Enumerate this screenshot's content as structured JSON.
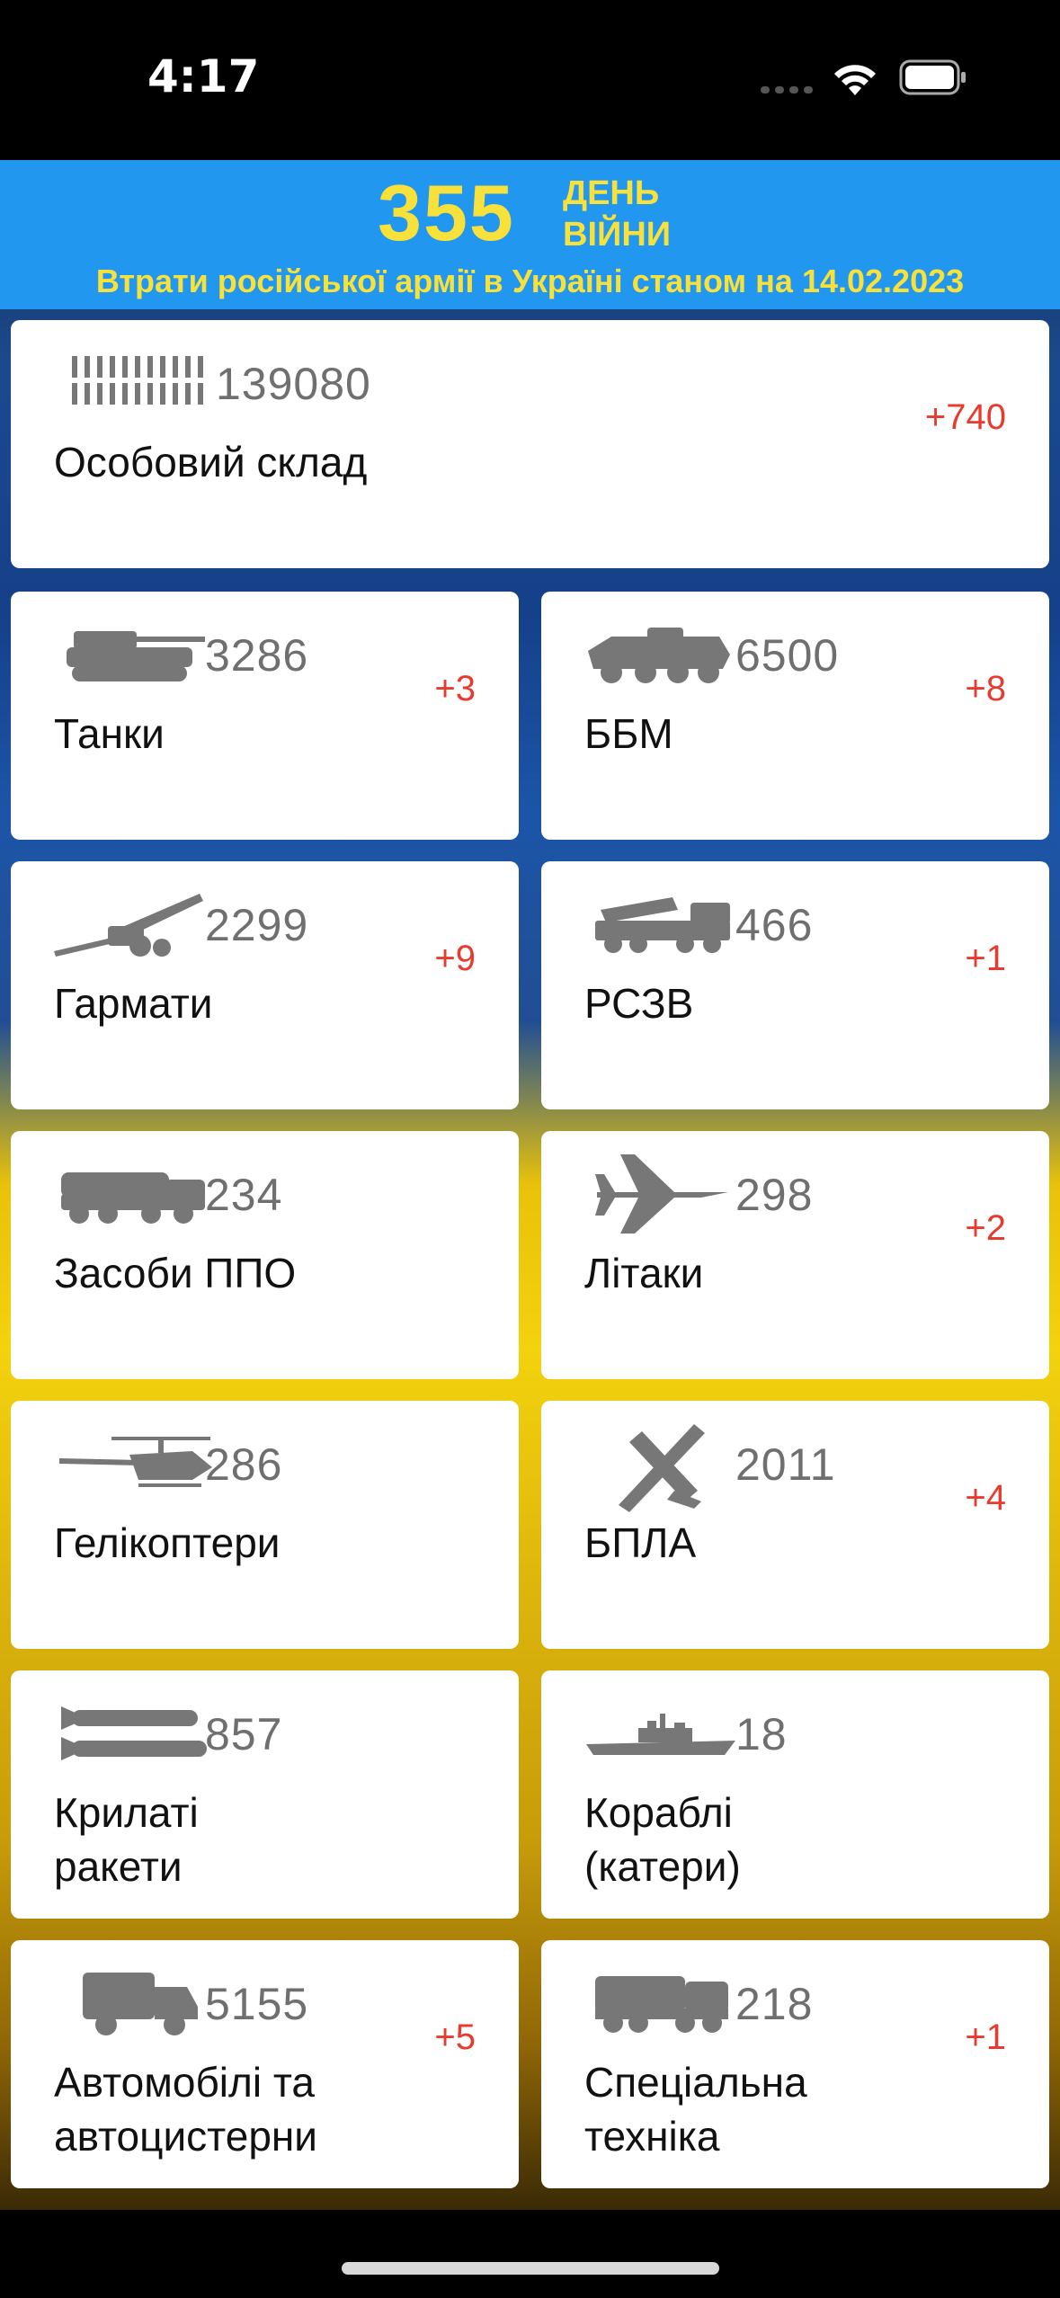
{
  "status_bar": {
    "time": "4:17"
  },
  "header": {
    "day_number": "355",
    "day_word_1": "ДЕНЬ",
    "day_word_2": "ВІЙНИ",
    "subtitle": "Втрати російської армії в Україні станом на 14.02.2023"
  },
  "colors": {
    "banner": "#2197f0",
    "title": "#f7e13a",
    "delta": "#e83b2e",
    "count": "#6f6f6f"
  },
  "cards": [
    {
      "name": "personnel",
      "icon": "soldiers-icon",
      "count": "139080",
      "delta": "+740",
      "label": "Особовий склад"
    },
    {
      "name": "tanks",
      "icon": "tank-icon",
      "count": "3286",
      "delta": "+3",
      "label": "Танки"
    },
    {
      "name": "apv",
      "icon": "armored-vehicle-icon",
      "count": "6500",
      "delta": "+8",
      "label": "ББМ"
    },
    {
      "name": "artillery",
      "icon": "howitzer-icon",
      "count": "2299",
      "delta": "+9",
      "label": "Гармати"
    },
    {
      "name": "mlrs",
      "icon": "mlrs-icon",
      "count": "466",
      "delta": "+1",
      "label": "РСЗВ"
    },
    {
      "name": "air-defense",
      "icon": "air-defense-icon",
      "count": "234",
      "delta": "",
      "label": "Засоби ППО"
    },
    {
      "name": "aircraft",
      "icon": "jet-icon",
      "count": "298",
      "delta": "+2",
      "label": "Літаки"
    },
    {
      "name": "helicopters",
      "icon": "helicopter-icon",
      "count": "286",
      "delta": "",
      "label": "Гелікоптери"
    },
    {
      "name": "drones",
      "icon": "drone-icon",
      "count": "2011",
      "delta": "+4",
      "label": "БПЛА"
    },
    {
      "name": "cruise-missiles",
      "icon": "missile-icon",
      "count": "857",
      "delta": "",
      "label": "Крилаті ракети"
    },
    {
      "name": "ships",
      "icon": "ship-icon",
      "count": "18",
      "delta": "",
      "label": "Кораблі (катери)"
    },
    {
      "name": "vehicles",
      "icon": "truck-icon",
      "count": "5155",
      "delta": "+5",
      "label": "Автомобілі та автоцистерни"
    },
    {
      "name": "special-equipment",
      "icon": "special-vehicle-icon",
      "count": "218",
      "delta": "+1",
      "label": "Спеціальна техніка"
    }
  ]
}
